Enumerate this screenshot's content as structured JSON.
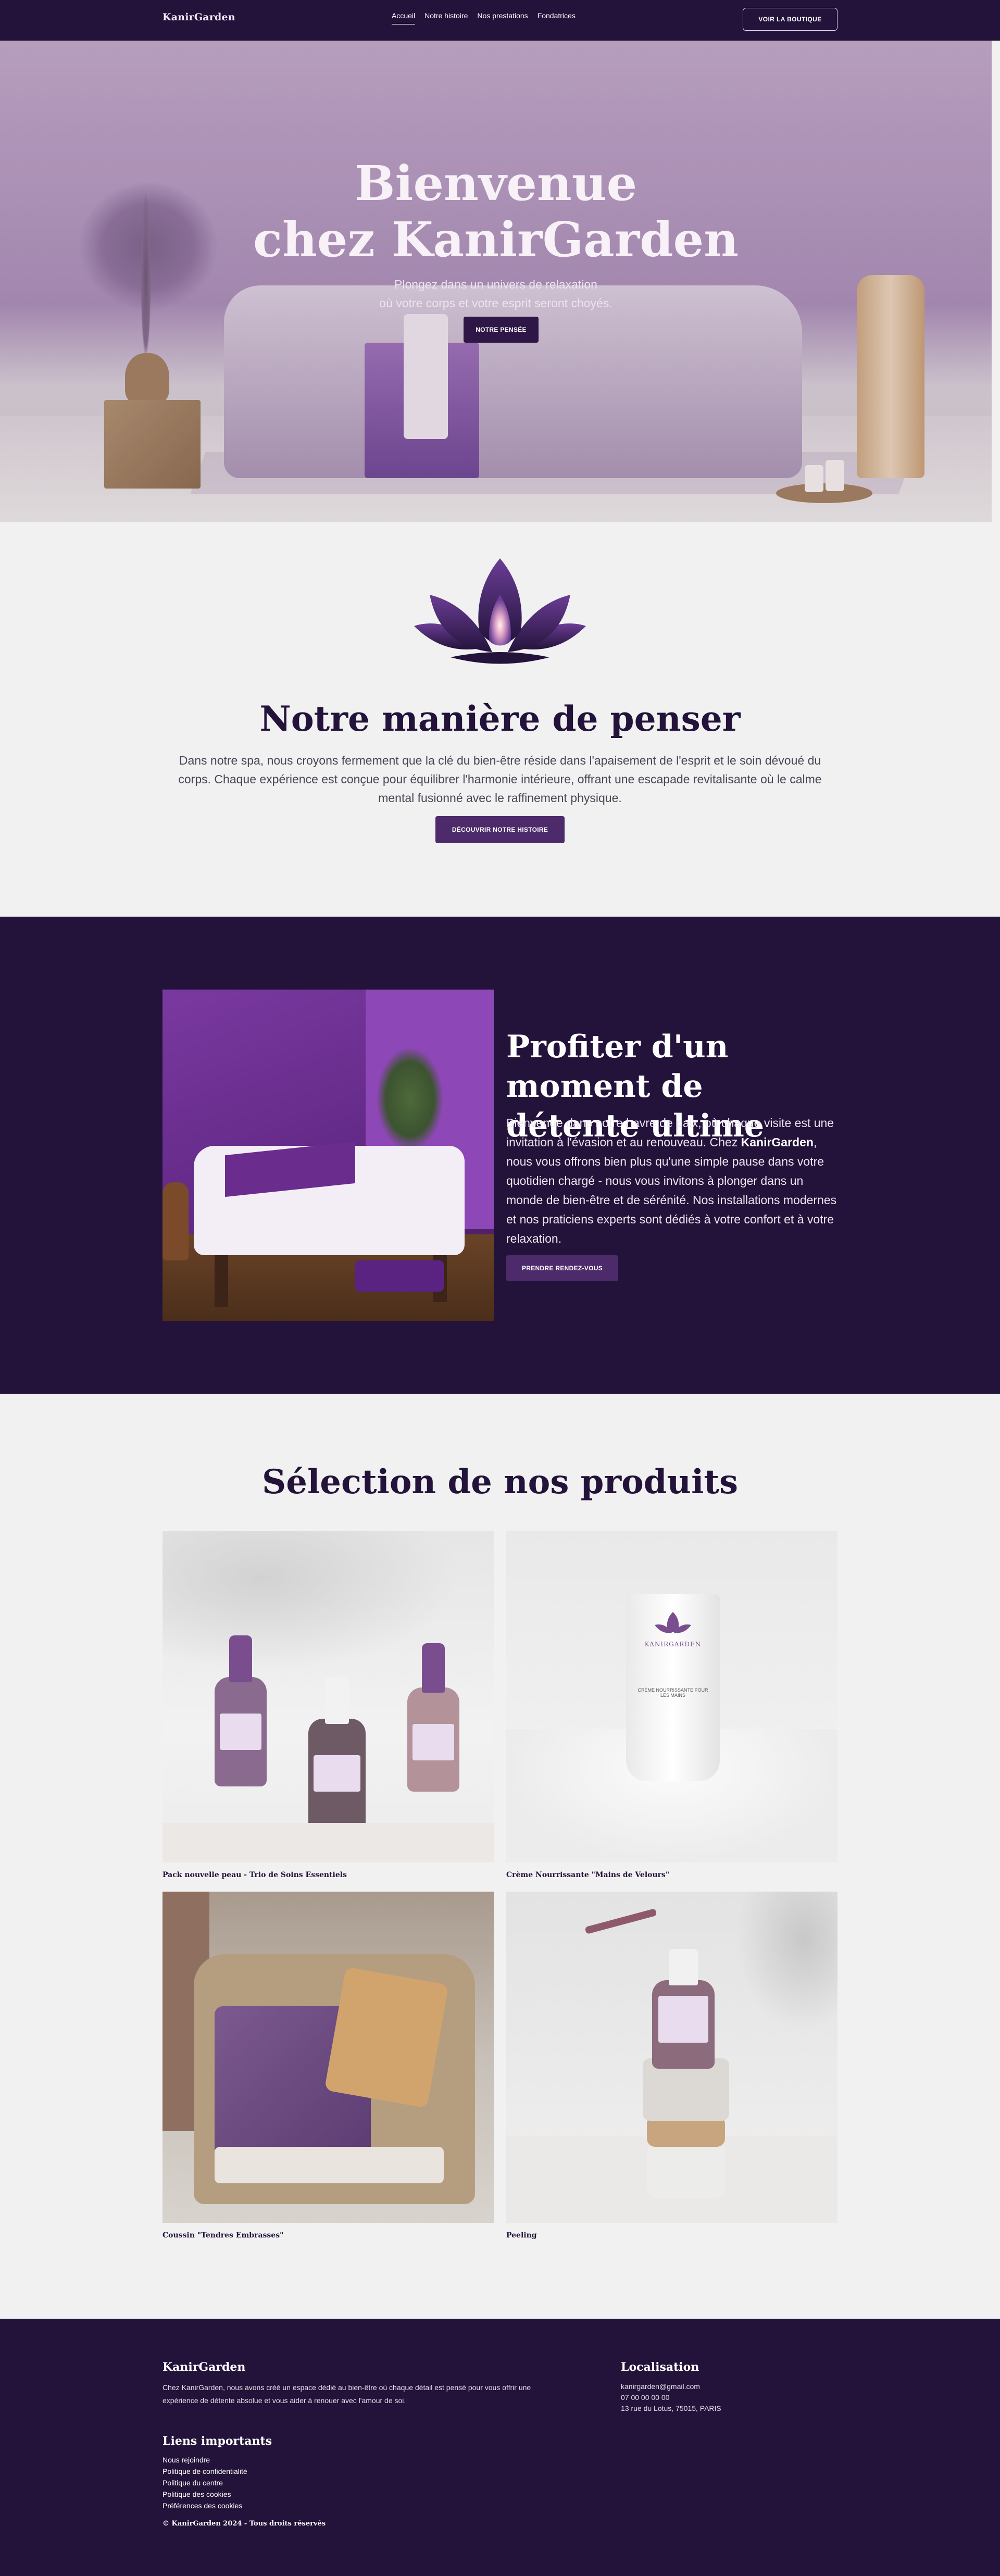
{
  "nav": {
    "brand": "KanirGarden",
    "links": [
      "Accueil",
      "Notre histoire",
      "Nos prestations",
      "Fondatrices"
    ],
    "active": "Accueil",
    "shop_button": "VOIR LA BOUTIQUE"
  },
  "hero": {
    "title_line1": "Bienvenue",
    "title_line2": "chez KanirGarden",
    "subtitle_line1": "Plongez dans un univers de relaxation",
    "subtitle_line2": "où votre corps et votre esprit seront choyés.",
    "cta": "NOTRE PENSÉE"
  },
  "philosophy": {
    "title": "Notre manière de penser",
    "text": "Dans notre spa, nous croyons fermement que la clé du bien-être réside dans l'apaisement de l'esprit et le soin dévoué du corps. Chaque expérience est conçue pour équilibrer l'harmonie intérieure, offrant une escapade revitalisante où le calme mental fusionné avec le raffinement physique.",
    "button": "DÉCOUVRIR NOTRE HISTOIRE"
  },
  "relax": {
    "title": "Profiter d'un moment de détente ultime",
    "text_before": "Bienvenue dans notre havre de paix, où chaque visite est une invitation à l'évasion et au renouveau. Chez ",
    "text_bold": "KanirGarden",
    "text_after": ", nous vous offrons bien plus qu'une simple pause dans votre quotidien chargé - nous vous invitons à plonger dans un monde de bien-être et de sérénité. Nos installations modernes et nos praticiens experts sont dédiés à votre confort et à votre relaxation.",
    "button": "PRENDRE RENDEZ-VOUS"
  },
  "products": {
    "title": "Sélection de nos produits",
    "items": [
      {
        "name": "Pack nouvelle peau - Trio de Soins Essentiels"
      },
      {
        "name": "Crème Nourrissante \"Mains de Velours\"",
        "tube_brand": "KANIRGARDEN",
        "tube_text": "CRÈME NOURRISSANTE POUR LES MAINS"
      },
      {
        "name": "Coussin \"Tendres Embrasses\""
      },
      {
        "name": "Peeling"
      }
    ]
  },
  "footer": {
    "brand": "KanirGarden",
    "description": "Chez KanirGarden, nous avons créé un espace dédié au bien-être où chaque détail est pensé pour vous offrir une expérience de détente absolue et vous aider à renouer avec l'amour de soi.",
    "location_title": "Localisation",
    "email": "kanirgarden@gmail.com",
    "phone": "07 00 00 00 00",
    "address": "13 rue du Lotus, 75015, PARIS",
    "links_title": "Liens importants",
    "links": [
      "Nous rejoindre",
      "Politique de confidentialité",
      "Politique du centre",
      "Politique des cookies",
      "Préférences des cookies"
    ],
    "copyright": "© KanirGarden 2024 - Tous droits réservés"
  },
  "colors": {
    "primary_dark": "#23133a",
    "button": "#4d2a6a",
    "background": "#f1f1f1"
  },
  "icons": {
    "logo": "lotus-icon"
  }
}
